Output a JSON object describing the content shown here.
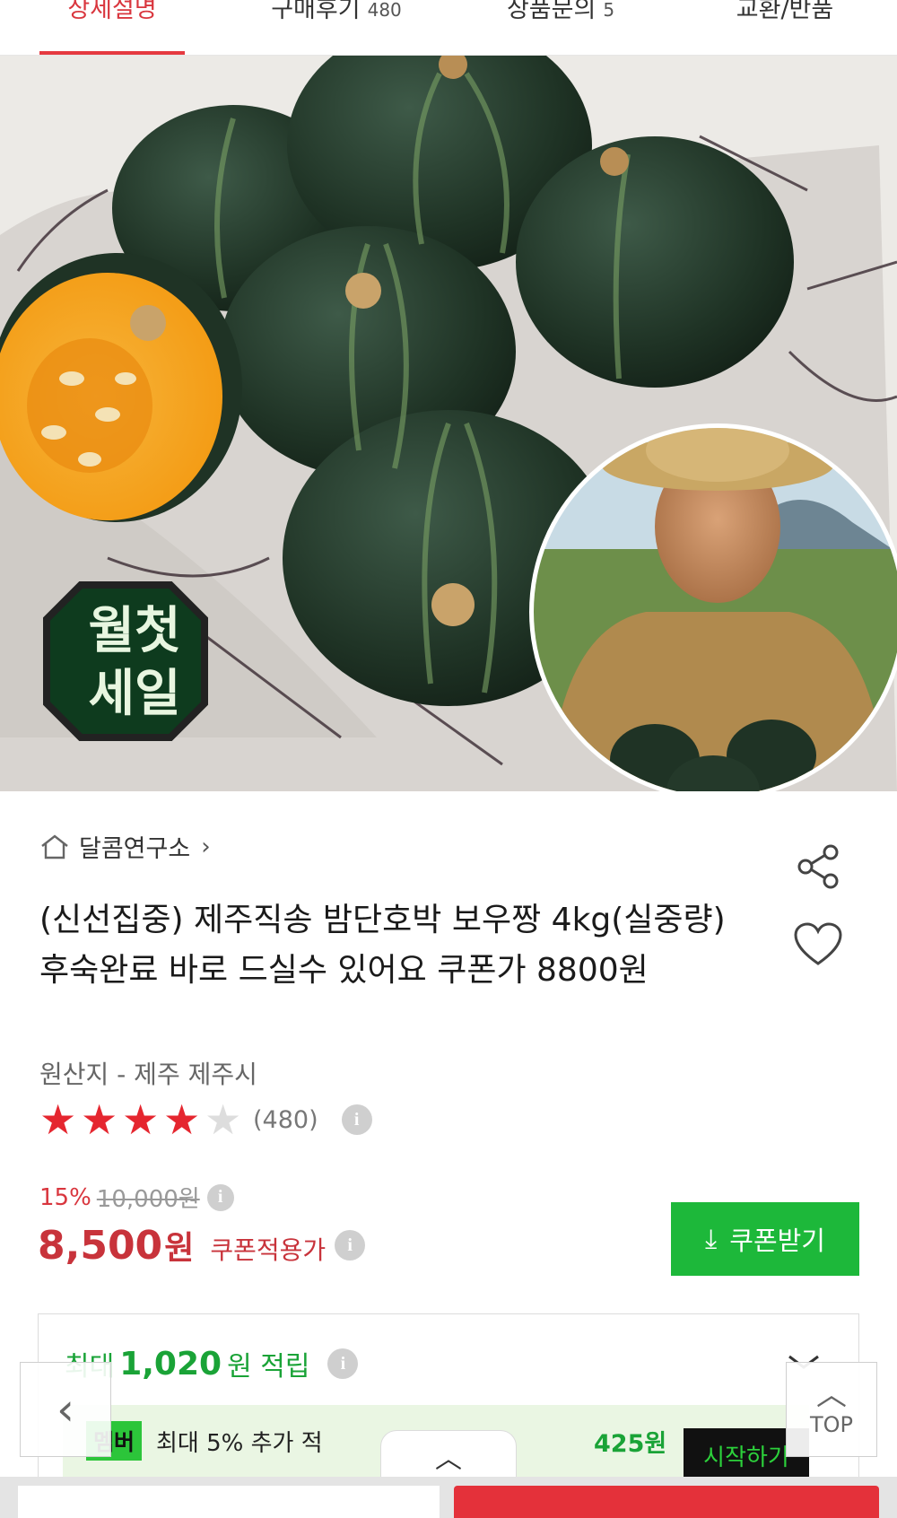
{
  "tabs": [
    {
      "label": "상세설명",
      "count": ""
    },
    {
      "label": "구매후기",
      "count": "480"
    },
    {
      "label": "상품문의",
      "count": "5"
    },
    {
      "label": "교환/반품",
      "count": ""
    }
  ],
  "hero": {
    "badge_line1": "월첫",
    "badge_line2": "세일",
    "alt": "pumpkins"
  },
  "shop": {
    "name": "달콤연구소",
    "chevron": "›"
  },
  "product": {
    "title": "(신선집중) 제주직송 밤단호박 보우짱 4kg(실중량) 후숙완료 바로 드실수 있어요 쿠폰가 8800원",
    "origin": "원산지 - 제주 제주시",
    "rating_value": 4,
    "rating_max": 5,
    "review_count": "(480)"
  },
  "pricing": {
    "discount_pct": "15%",
    "original_price": "10,000원",
    "price": "8,500",
    "price_unit": "원",
    "price_label": "쿠폰적용가",
    "coupon_button": "쿠폰받기"
  },
  "points": {
    "prefix": "최대",
    "value": "1,020",
    "suffix": "원 적립"
  },
  "member": {
    "badge": "멤버",
    "text": "최대 5% 추가 적",
    "value": "425원",
    "start": "시작하기"
  },
  "controls": {
    "back": "‹",
    "top_arrow": "︿",
    "top_label": "TOP",
    "pull_tab": "︿"
  },
  "colors": {
    "accent_red": "#e53a40",
    "price_red": "#c8333b",
    "coupon_green": "#1db83a",
    "points_green": "#1aa337"
  }
}
